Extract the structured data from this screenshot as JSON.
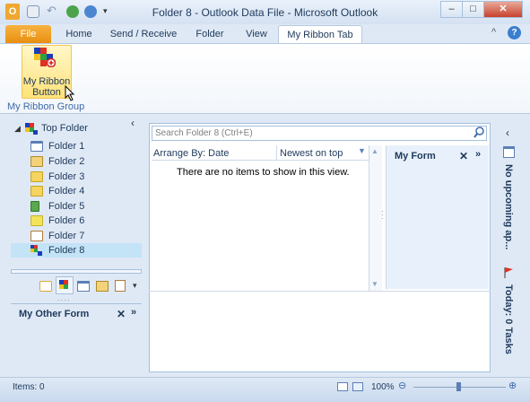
{
  "window": {
    "title": "Folder 8 - Outlook Data File - Microsoft Outlook"
  },
  "tabs": [
    "File",
    "Home",
    "Send / Receive",
    "Folder",
    "View",
    "My Ribbon Tab"
  ],
  "ribbon": {
    "button_line1": "My Ribbon",
    "button_line2": "Button",
    "group_label": "My Ribbon Group"
  },
  "nav": {
    "top_folder": "Top Folder",
    "folders": [
      "Folder 1",
      "Folder 2",
      "Folder 3",
      "Folder 4",
      "Folder 5",
      "Folder 6",
      "Folder 7",
      "Folder 8"
    ],
    "selected": "Folder 8",
    "other_form": "My Other Form"
  },
  "search": {
    "placeholder": "Search Folder 8 (Ctrl+E)"
  },
  "list": {
    "arrange_by": "Arrange By: Date",
    "sort": "Newest on top",
    "empty_message": "There are no items to show in this view."
  },
  "form": {
    "title": "My Form"
  },
  "todo": {
    "appointments": "No upcoming ap...",
    "tasks": "Today: 0 Tasks"
  },
  "status": {
    "items": "Items: 0",
    "zoom": "100%"
  },
  "colors": {
    "accent": "#e88e0f",
    "selected_row": "#c3e3f7",
    "form_bg": "#e8f1fb"
  }
}
